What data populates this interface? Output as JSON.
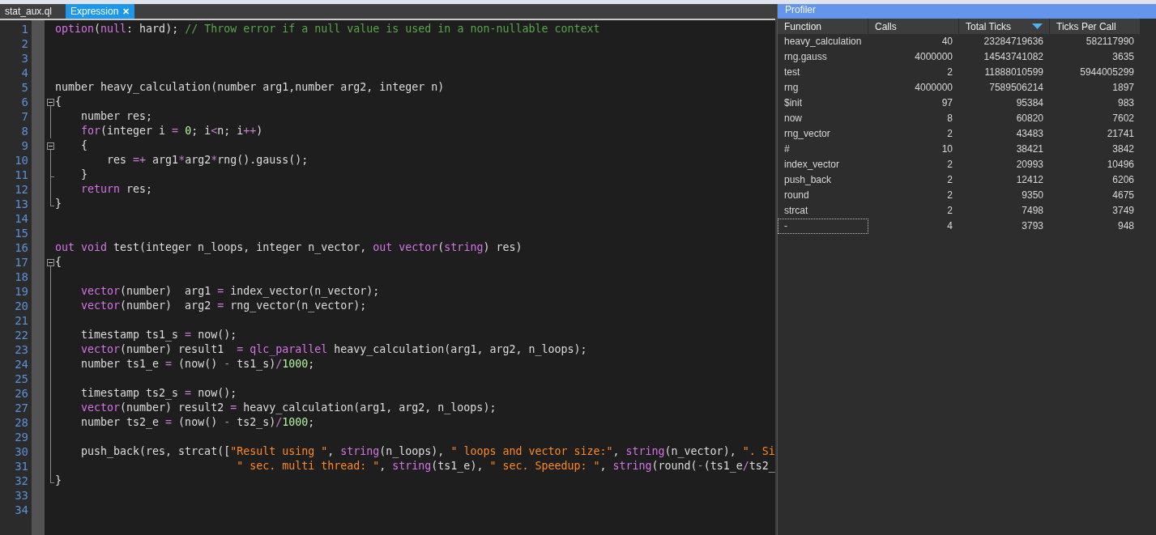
{
  "tabs": [
    {
      "label": "stat_aux.ql",
      "selected": false
    },
    {
      "label": "Expression",
      "selected": true,
      "close_glyph": "✕"
    }
  ],
  "editor": {
    "lines": [
      {
        "number": "1",
        "tokens": [
          {
            "kind": "keyword",
            "text": "option"
          },
          {
            "kind": "plain",
            "text": "("
          },
          {
            "kind": "keyword",
            "text": "null"
          },
          {
            "kind": "plain",
            "text": ": hard); "
          },
          {
            "kind": "comment",
            "text": "// Throw error if a null value is used in a non-nullable context"
          }
        ]
      },
      {
        "number": "2"
      },
      {
        "number": "3"
      },
      {
        "number": "4"
      },
      {
        "number": "5",
        "tokens": [
          {
            "kind": "plain",
            "text": "number heavy_calculation(number arg1,number arg2, integer n)"
          }
        ]
      },
      {
        "number": "6",
        "fold": {
          "kind": "open"
        },
        "tokens": [
          {
            "kind": "plain",
            "text": "{"
          }
        ]
      },
      {
        "number": "7",
        "fold": {
          "kind": "line"
        },
        "tokens": [
          {
            "kind": "plain",
            "text": "    number res;"
          }
        ]
      },
      {
        "number": "8",
        "fold": {
          "kind": "line"
        },
        "tokens": [
          {
            "kind": "keyword",
            "text": "    for"
          },
          {
            "kind": "plain",
            "text": "(integer i "
          },
          {
            "kind": "operator",
            "text": "="
          },
          {
            "kind": "number",
            "text": " 0"
          },
          {
            "kind": "plain",
            "text": "; i"
          },
          {
            "kind": "operator",
            "text": "<"
          },
          {
            "kind": "plain",
            "text": "n; i"
          },
          {
            "kind": "operator",
            "text": "++"
          },
          {
            "kind": "plain",
            "text": ")"
          }
        ]
      },
      {
        "number": "9",
        "fold": {
          "kind": "open"
        },
        "tokens": [
          {
            "kind": "plain",
            "text": "    {"
          }
        ]
      },
      {
        "number": "10",
        "fold": {
          "kind": "line"
        },
        "tokens": [
          {
            "kind": "plain",
            "text": "        res "
          },
          {
            "kind": "operator",
            "text": "=+"
          },
          {
            "kind": "plain",
            "text": " arg1"
          },
          {
            "kind": "operator",
            "text": "*"
          },
          {
            "kind": "plain",
            "text": "arg2"
          },
          {
            "kind": "operator",
            "text": "*"
          },
          {
            "kind": "plain",
            "text": "rng().gauss();"
          }
        ]
      },
      {
        "number": "11",
        "fold": {
          "kind": "end"
        },
        "tokens": [
          {
            "kind": "plain",
            "text": "    }"
          }
        ]
      },
      {
        "number": "12",
        "fold": {
          "kind": "line"
        },
        "tokens": [
          {
            "kind": "keyword",
            "text": "    return"
          },
          {
            "kind": "plain",
            "text": " res;"
          }
        ]
      },
      {
        "number": "13",
        "fold": {
          "kind": "close"
        },
        "tokens": [
          {
            "kind": "plain",
            "text": "}"
          }
        ]
      },
      {
        "number": "14"
      },
      {
        "number": "15"
      },
      {
        "number": "16",
        "tokens": [
          {
            "kind": "keyword",
            "text": "out void"
          },
          {
            "kind": "plain",
            "text": " test(integer n_loops, integer n_vector, "
          },
          {
            "kind": "keyword",
            "text": "out vector"
          },
          {
            "kind": "plain",
            "text": "("
          },
          {
            "kind": "keyword",
            "text": "string"
          },
          {
            "kind": "plain",
            "text": ") res)"
          }
        ]
      },
      {
        "number": "17",
        "fold": {
          "kind": "open"
        },
        "tokens": [
          {
            "kind": "plain",
            "text": "{"
          }
        ]
      },
      {
        "number": "18",
        "fold": {
          "kind": "line"
        }
      },
      {
        "number": "19",
        "fold": {
          "kind": "line"
        },
        "tokens": [
          {
            "kind": "keyword",
            "text": "    vector"
          },
          {
            "kind": "plain",
            "text": "(number)  arg1 "
          },
          {
            "kind": "operator",
            "text": "="
          },
          {
            "kind": "plain",
            "text": " index_vector(n_vector);"
          }
        ]
      },
      {
        "number": "20",
        "fold": {
          "kind": "line"
        },
        "tokens": [
          {
            "kind": "keyword",
            "text": "    vector"
          },
          {
            "kind": "plain",
            "text": "(number)  arg2 "
          },
          {
            "kind": "operator",
            "text": "="
          },
          {
            "kind": "plain",
            "text": " rng_vector(n_vector);"
          }
        ]
      },
      {
        "number": "21",
        "fold": {
          "kind": "line"
        }
      },
      {
        "number": "22",
        "fold": {
          "kind": "line"
        },
        "tokens": [
          {
            "kind": "plain",
            "text": "    timestamp ts1_s "
          },
          {
            "kind": "operator",
            "text": "="
          },
          {
            "kind": "plain",
            "text": " now();"
          }
        ]
      },
      {
        "number": "23",
        "fold": {
          "kind": "line"
        },
        "tokens": [
          {
            "kind": "keyword",
            "text": "    vector"
          },
          {
            "kind": "plain",
            "text": "(number) result1  "
          },
          {
            "kind": "operator",
            "text": "="
          },
          {
            "kind": "keyword",
            "text": " qlc_parallel"
          },
          {
            "kind": "plain",
            "text": " heavy_calculation(arg1, arg2, n_loops);"
          }
        ]
      },
      {
        "number": "24",
        "fold": {
          "kind": "line"
        },
        "tokens": [
          {
            "kind": "plain",
            "text": "    number ts1_e "
          },
          {
            "kind": "operator",
            "text": "="
          },
          {
            "kind": "plain",
            "text": " (now() "
          },
          {
            "kind": "operator",
            "text": "-"
          },
          {
            "kind": "plain",
            "text": " ts1_s)"
          },
          {
            "kind": "operator",
            "text": "/"
          },
          {
            "kind": "number",
            "text": "1000"
          },
          {
            "kind": "plain",
            "text": ";"
          }
        ]
      },
      {
        "number": "25",
        "fold": {
          "kind": "line"
        }
      },
      {
        "number": "26",
        "fold": {
          "kind": "line"
        },
        "tokens": [
          {
            "kind": "plain",
            "text": "    timestamp ts2_s "
          },
          {
            "kind": "operator",
            "text": "="
          },
          {
            "kind": "plain",
            "text": " now();"
          }
        ]
      },
      {
        "number": "27",
        "fold": {
          "kind": "line"
        },
        "tokens": [
          {
            "kind": "keyword",
            "text": "    vector"
          },
          {
            "kind": "plain",
            "text": "(number) result2 "
          },
          {
            "kind": "operator",
            "text": "="
          },
          {
            "kind": "plain",
            "text": " heavy_calculation(arg1, arg2, n_loops);"
          }
        ]
      },
      {
        "number": "28",
        "fold": {
          "kind": "line"
        },
        "tokens": [
          {
            "kind": "plain",
            "text": "    number ts2_e "
          },
          {
            "kind": "operator",
            "text": "="
          },
          {
            "kind": "plain",
            "text": " (now() "
          },
          {
            "kind": "operator",
            "text": "-"
          },
          {
            "kind": "plain",
            "text": " ts2_s)"
          },
          {
            "kind": "operator",
            "text": "/"
          },
          {
            "kind": "number",
            "text": "1000"
          },
          {
            "kind": "plain",
            "text": ";"
          }
        ]
      },
      {
        "number": "29",
        "fold": {
          "kind": "line"
        }
      },
      {
        "number": "30",
        "fold": {
          "kind": "line"
        },
        "tokens": [
          {
            "kind": "plain",
            "text": "    push_back(res, strcat(["
          },
          {
            "kind": "string",
            "text": "\"Result using \""
          },
          {
            "kind": "plain",
            "text": ", "
          },
          {
            "kind": "keyword",
            "text": "string"
          },
          {
            "kind": "plain",
            "text": "(n_loops), "
          },
          {
            "kind": "string",
            "text": "\" loops and vector size:\""
          },
          {
            "kind": "plain",
            "text": ", "
          },
          {
            "kind": "keyword",
            "text": "string"
          },
          {
            "kind": "plain",
            "text": "(n_vector), "
          },
          {
            "kind": "string",
            "text": "\". Si"
          }
        ]
      },
      {
        "number": "31",
        "fold": {
          "kind": "line"
        },
        "tokens": [
          {
            "kind": "string",
            "text": "                            \" sec. multi thread: \""
          },
          {
            "kind": "plain",
            "text": ", "
          },
          {
            "kind": "keyword",
            "text": "string"
          },
          {
            "kind": "plain",
            "text": "(ts1_e), "
          },
          {
            "kind": "string",
            "text": "\" sec. Speedup: \""
          },
          {
            "kind": "plain",
            "text": ", "
          },
          {
            "kind": "keyword",
            "text": "string"
          },
          {
            "kind": "plain",
            "text": "(round("
          },
          {
            "kind": "operator",
            "text": "-"
          },
          {
            "kind": "plain",
            "text": "(ts1_e"
          },
          {
            "kind": "operator",
            "text": "/"
          },
          {
            "kind": "plain",
            "text": "ts2_"
          }
        ]
      },
      {
        "number": "32",
        "fold": {
          "kind": "close"
        },
        "tokens": [
          {
            "kind": "plain",
            "text": "}"
          }
        ]
      },
      {
        "number": "33"
      },
      {
        "number": "34"
      }
    ]
  },
  "profiler": {
    "title": "Profiler",
    "columns": [
      {
        "label": "Function",
        "sorted": false
      },
      {
        "label": "Calls",
        "sorted": false
      },
      {
        "label": "Total Ticks",
        "sorted": true
      },
      {
        "label": "Ticks Per Call",
        "sorted": false
      }
    ],
    "rows": [
      {
        "cells": [
          "heavy_calculation",
          "40",
          "23284719636",
          "582117990"
        ],
        "focused": false
      },
      {
        "cells": [
          "rng.gauss",
          "4000000",
          "14543741082",
          "3635"
        ],
        "focused": false
      },
      {
        "cells": [
          "test",
          "2",
          "11888010599",
          "5944005299"
        ],
        "focused": false
      },
      {
        "cells": [
          "rng",
          "4000000",
          "7589506214",
          "1897"
        ],
        "focused": false
      },
      {
        "cells": [
          "$init",
          "97",
          "95384",
          "983"
        ],
        "focused": false
      },
      {
        "cells": [
          "now",
          "8",
          "60820",
          "7602"
        ],
        "focused": false
      },
      {
        "cells": [
          "rng_vector",
          "2",
          "43483",
          "21741"
        ],
        "focused": false
      },
      {
        "cells": [
          "#",
          "10",
          "38421",
          "3842"
        ],
        "focused": false
      },
      {
        "cells": [
          "index_vector",
          "2",
          "20993",
          "10496"
        ],
        "focused": false
      },
      {
        "cells": [
          "push_back",
          "2",
          "12412",
          "6206"
        ],
        "focused": false
      },
      {
        "cells": [
          "round",
          "2",
          "9350",
          "4675"
        ],
        "focused": false
      },
      {
        "cells": [
          "strcat",
          "2",
          "7498",
          "3749"
        ],
        "focused": false
      },
      {
        "cells": [
          "-",
          "4",
          "3793",
          "948"
        ],
        "focused": true
      }
    ]
  }
}
